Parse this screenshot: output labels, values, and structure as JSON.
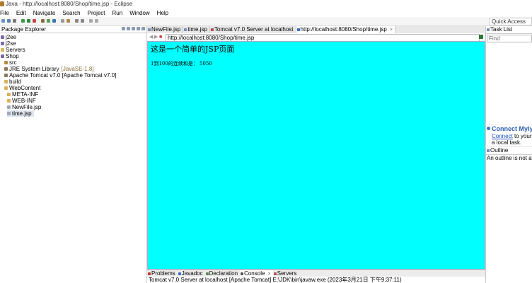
{
  "window": {
    "title": "Java - http://localhost:8080/Shop/time.jsp - Eclipse"
  },
  "menu": [
    "File",
    "Edit",
    "Navigate",
    "Search",
    "Project",
    "Run",
    "Window",
    "Help"
  ],
  "toolbar": {
    "quick_access": "Quick Access"
  },
  "package_explorer": {
    "title": "Package Explorer",
    "items": [
      {
        "label": "j2ee",
        "depth": 0,
        "icon": "project-icon"
      },
      {
        "label": "j2se",
        "depth": 0,
        "icon": "project-icon"
      },
      {
        "label": "Servers",
        "depth": 0,
        "icon": "folder-icon"
      },
      {
        "label": "Shop",
        "depth": 0,
        "icon": "project-icon"
      },
      {
        "label": "src",
        "depth": 1,
        "icon": "source-folder-icon"
      },
      {
        "label": "JRE System Library",
        "suffix": "[JavaSE-1.8]",
        "depth": 1,
        "icon": "library-icon"
      },
      {
        "label": "Apache Tomcat v7.0 [Apache Tomcat v7.0]",
        "depth": 1,
        "icon": "library-icon"
      },
      {
        "label": "build",
        "depth": 1,
        "icon": "folder-icon"
      },
      {
        "label": "WebContent",
        "depth": 1,
        "icon": "folder-icon"
      },
      {
        "label": "META-INF",
        "depth": 2,
        "icon": "folder-icon"
      },
      {
        "label": "WEB-INF",
        "depth": 2,
        "icon": "folder-icon"
      },
      {
        "label": "NewFile.jsp",
        "depth": 2,
        "icon": "jsp-file-icon"
      },
      {
        "label": "time.jsp",
        "depth": 2,
        "icon": "jsp-file-icon",
        "selected": true
      }
    ]
  },
  "editor": {
    "tabs": [
      {
        "label": "NewFile.jsp"
      },
      {
        "label": "time.jsp"
      },
      {
        "label": "Tomcat v7.0 Server at localhost"
      },
      {
        "label": "http://localhost:8080/Shop/time.jsp",
        "active": true
      }
    ],
    "url": "http://localhost:8080/Shop/time.jsp",
    "page": {
      "heading": "这是一个简单的JSP页面",
      "body": "1到100的连续和是： 5050",
      "background": "#00ffff"
    }
  },
  "bottom": {
    "tabs": [
      {
        "label": "Problems"
      },
      {
        "label": "Javadoc"
      },
      {
        "label": "Declaration"
      },
      {
        "label": "Console",
        "active": true
      },
      {
        "label": "Servers"
      }
    ],
    "console_line": "Tomcat v7.0 Server at localhost [Apache Tomcat] E:\\JDK\\bin\\javaw.exe (2023年3月21日 下午9:37:11)"
  },
  "right": {
    "task_list": {
      "title": "Task List",
      "find_placeholder": "Find"
    },
    "mylyn": {
      "title": "Connect Mylyn",
      "link": "Connect",
      "text_after_link": " to your ta",
      "line2": "a local task."
    },
    "outline": {
      "title": "Outline",
      "message": "An outline is not ava"
    }
  }
}
